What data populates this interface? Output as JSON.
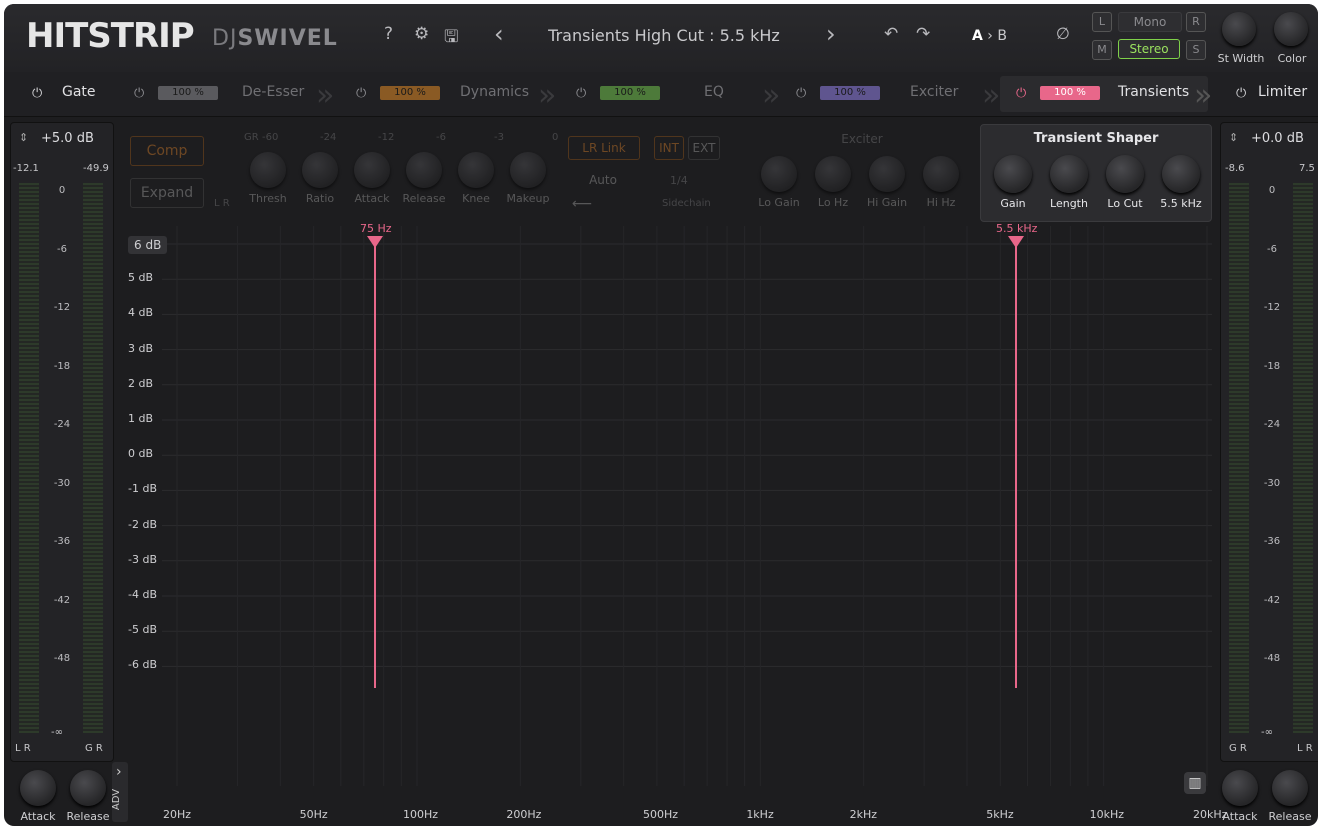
{
  "header": {
    "logo": "HITSTRIP",
    "brand_dj": "DJ",
    "brand_swivel": "SWIVEL",
    "help_icon": "?",
    "settings_icon": "⚙",
    "save_icon": "🖫",
    "prev_icon": "‹",
    "next_icon": "›",
    "title": "Transients High Cut : 5.5 kHz",
    "undo_icon": "↶",
    "redo_icon": "↷",
    "ab_a": "A",
    "ab_sep": " › ",
    "ab_b": "B",
    "phase_icon": "∅",
    "btn_l": "L",
    "btn_r": "R",
    "btn_m": "M",
    "btn_s": "S",
    "mono_label": "Mono",
    "stereo_label": "Stereo",
    "st_width_label": "St Width",
    "color_label": "Color"
  },
  "tabs": [
    {
      "label": "Gate",
      "mix": "",
      "color": "",
      "active": true
    },
    {
      "label": "De-Esser",
      "mix": "100 %",
      "color": "#8a8a8e",
      "active": false
    },
    {
      "label": "Dynamics",
      "mix": "100 %",
      "color": "#c0782a",
      "active": false
    },
    {
      "label": "EQ",
      "mix": "100 %",
      "color": "#6aa84f",
      "active": false
    },
    {
      "label": "Exciter",
      "mix": "100 %",
      "color": "#8074c9",
      "active": false
    },
    {
      "label": "Transients",
      "mix": "100 %",
      "color": "#e8678a",
      "active": true
    },
    {
      "label": "Limiter",
      "mix": "",
      "color": "",
      "active": true
    }
  ],
  "power_icon": "⏻",
  "left_meter": {
    "gain": "+5.0 dB",
    "peak_l": "-12.1",
    "peak_r": "-49.9",
    "bottom_l": "L R",
    "bottom_r": "G R",
    "inf": "-∞"
  },
  "right_meter": {
    "gain": "+0.0 dB",
    "peak_l": "-8.6",
    "peak_r": "7.5",
    "bottom_l": "G R",
    "bottom_r": "L R",
    "inf": "-∞"
  },
  "meter_scale": [
    "0",
    "-6",
    "-12",
    "-18",
    "-24",
    "-30",
    "-36",
    "-42",
    "-48"
  ],
  "dynamics": {
    "comp": "Comp",
    "expand": "Expand",
    "gr": "GR",
    "lr": "L R",
    "gr_scale": [
      "-60",
      "-24",
      "-12",
      "-6",
      "-3",
      "0"
    ],
    "knobs": [
      "Thresh",
      "Ratio",
      "Attack",
      "Release",
      "Knee",
      "Makeup"
    ],
    "lr_link": "LR Link",
    "int": "INT",
    "ext": "EXT",
    "auto": "Auto",
    "rate": "1/4",
    "sidechain": "Sidechain"
  },
  "exciter": {
    "title": "Exciter",
    "knobs": [
      "Lo Gain",
      "Lo Hz",
      "Hi Gain",
      "Hi Hz"
    ]
  },
  "transient_shaper": {
    "title": "Transient Shaper",
    "knobs": [
      "Gain",
      "Length",
      "Lo Cut",
      "5.5 kHz"
    ]
  },
  "plot": {
    "db_labels": [
      "6 dB",
      "5 dB",
      "4 dB",
      "3 dB",
      "2 dB",
      "1 dB",
      "0 dB",
      "-1 dB",
      "-2 dB",
      "-3 dB",
      "-4 dB",
      "-5 dB",
      "-6 dB"
    ],
    "hz_labels": [
      "20Hz",
      "50Hz",
      "100Hz",
      "200Hz",
      "500Hz",
      "1kHz",
      "2kHz",
      "5kHz",
      "10kHz",
      "20kHz"
    ],
    "marker_low": "75 Hz",
    "marker_high": "5.5 kHz"
  },
  "footer": {
    "attack": "Attack",
    "release": "Release",
    "adv": "ADV",
    "adv_chev": "›",
    "piano_icon": "▥"
  }
}
